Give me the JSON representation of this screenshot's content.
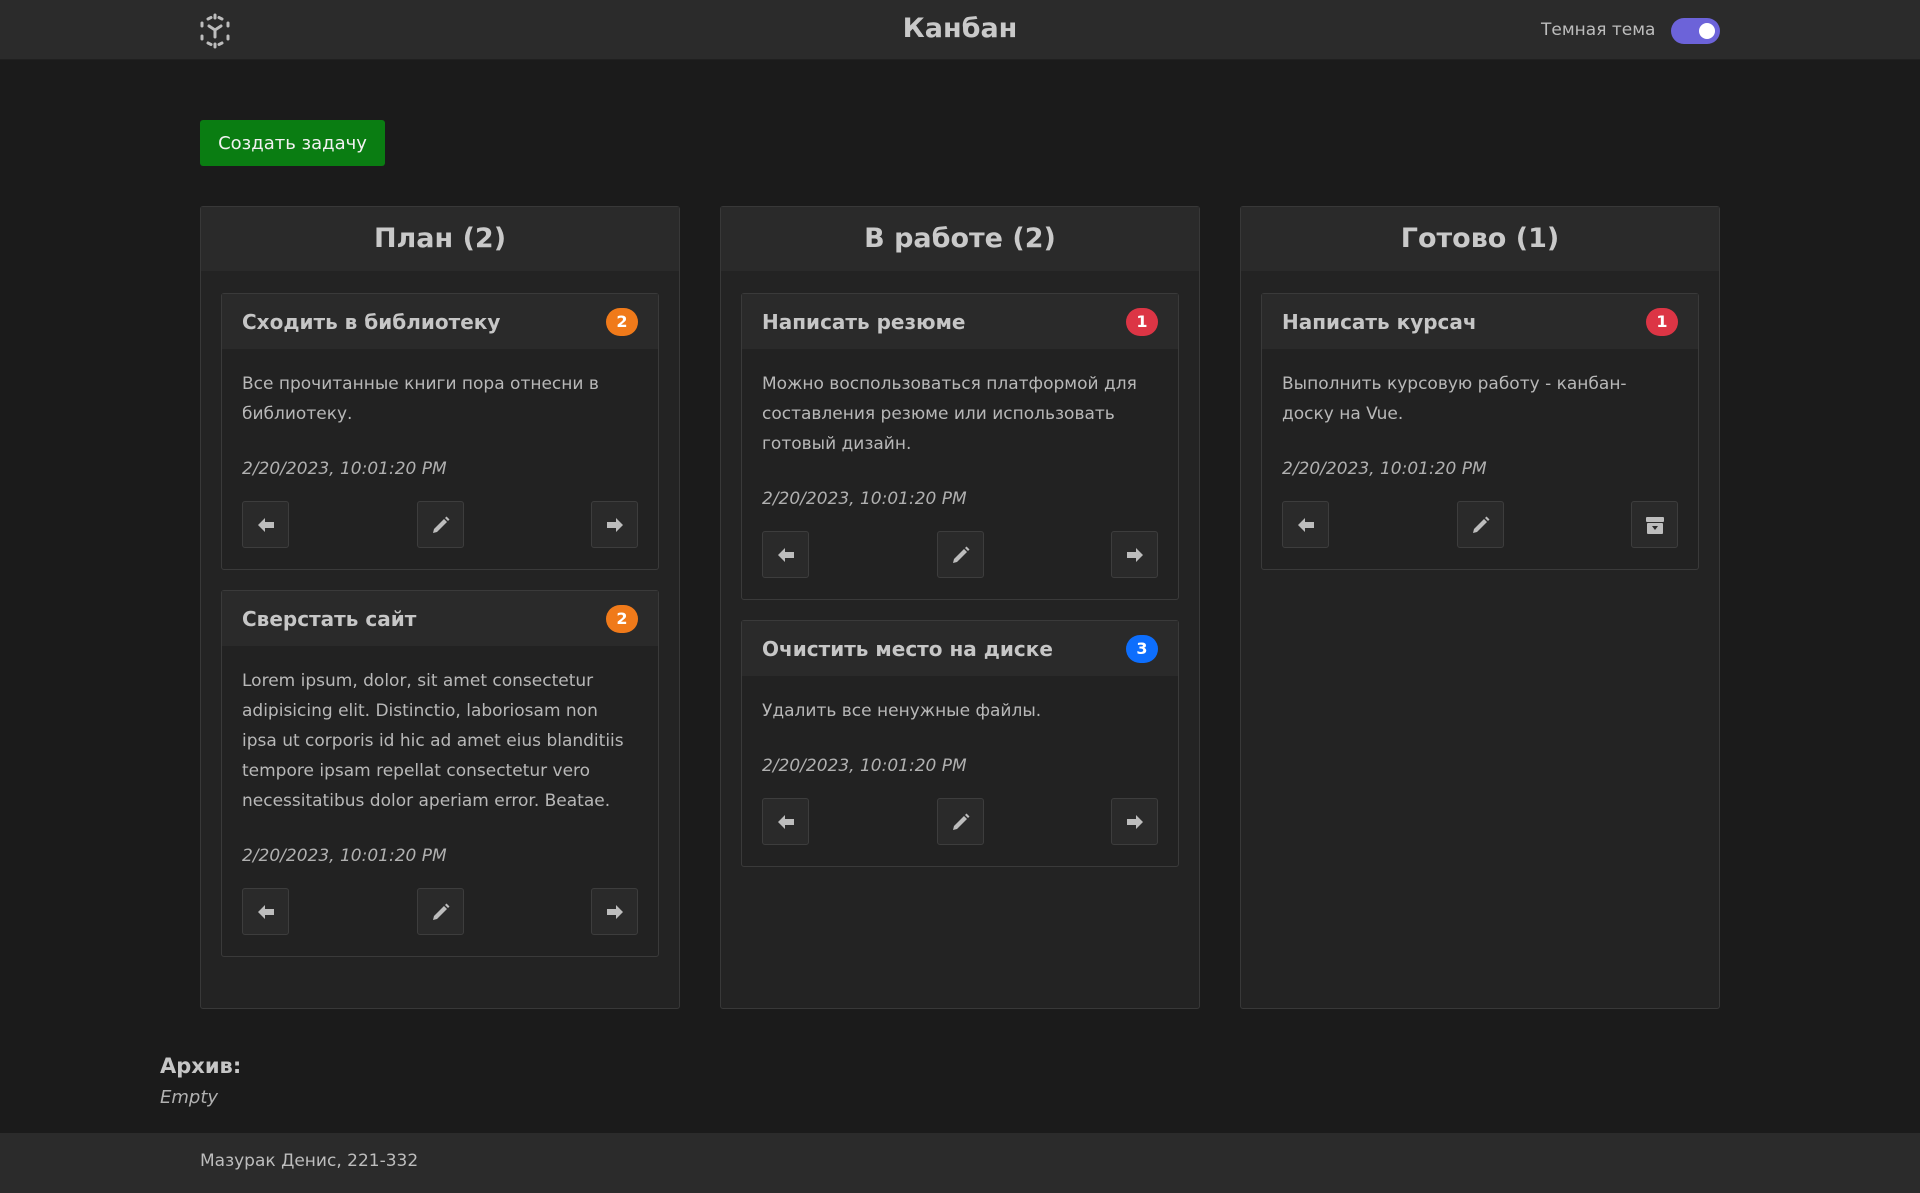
{
  "header": {
    "title": "Канбан",
    "theme_label": "Темная тема",
    "theme_dark_on": true
  },
  "toolbar": {
    "create_label": "Создать задачу"
  },
  "columns": [
    {
      "title": "План (2)",
      "cards": [
        {
          "title": "Сходить в библиотеку",
          "priority": "2",
          "priority_color": "#f07a1a",
          "description": "Все прочитанные книги пора отнесни в библиотеку.",
          "date": "2/20/2023, 10:01:20 PM",
          "actions": [
            "arrow-left-icon",
            "pencil-icon",
            "arrow-right-icon"
          ]
        },
        {
          "title": "Сверстать сайт",
          "priority": "2",
          "priority_color": "#f07a1a",
          "description": "Lorem ipsum, dolor, sit amet consectetur adipisicing elit. Distinctio, laboriosam non ipsa ut corporis id hic ad amet eius blanditiis tempore ipsam repellat consectetur vero necessitatibus dolor aperiam error. Beatae.",
          "date": "2/20/2023, 10:01:20 PM",
          "actions": [
            "arrow-left-icon",
            "pencil-icon",
            "arrow-right-icon"
          ]
        }
      ]
    },
    {
      "title": "В работе (2)",
      "cards": [
        {
          "title": "Написать резюме",
          "priority": "1",
          "priority_color": "#dc3545",
          "description": "Можно воспользоваться платформой для составления резюме или использовать готовый дизайн.",
          "date": "2/20/2023, 10:01:20 PM",
          "actions": [
            "arrow-left-icon",
            "pencil-icon",
            "arrow-right-icon"
          ]
        },
        {
          "title": "Очистить место на диске",
          "priority": "3",
          "priority_color": "#0d6efd",
          "description": "Удалить все ненужные файлы.",
          "date": "2/20/2023, 10:01:20 PM",
          "actions": [
            "arrow-left-icon",
            "pencil-icon",
            "arrow-right-icon"
          ]
        }
      ]
    },
    {
      "title": "Готово (1)",
      "cards": [
        {
          "title": "Написать курсач",
          "priority": "1",
          "priority_color": "#dc3545",
          "description": "Выполнить курсовую работу - канбан-доску на Vue.",
          "date": "2/20/2023, 10:01:20 PM",
          "actions": [
            "arrow-left-icon",
            "pencil-icon",
            "archive-icon"
          ]
        }
      ]
    }
  ],
  "archive": {
    "title": "Архив:",
    "empty_text": "Empty"
  },
  "footer": {
    "text": "Мазурак Денис, 221-332"
  },
  "colors": {
    "create_button": "#0a7d12",
    "toggle_on": "#6c63d9",
    "priority_1": "#dc3545",
    "priority_2": "#f07a1a",
    "priority_3": "#0d6efd"
  }
}
